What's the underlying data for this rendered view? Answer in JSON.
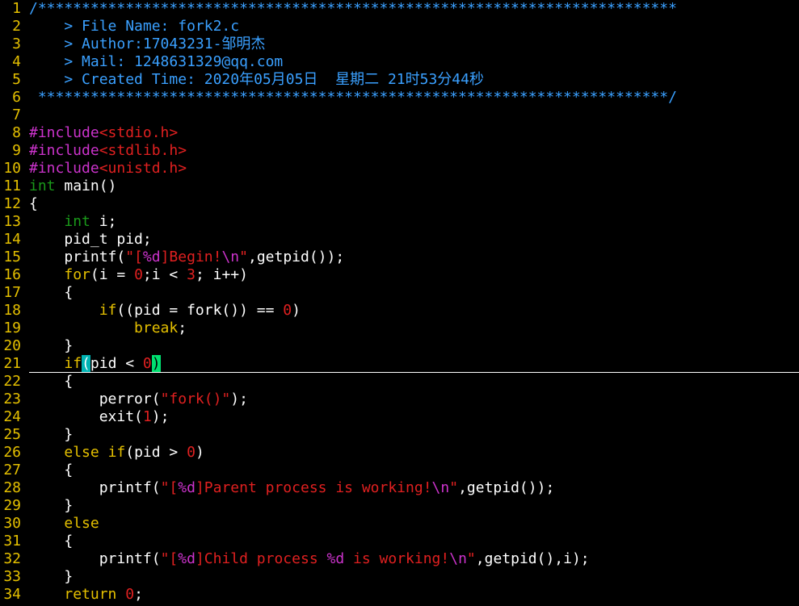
{
  "colors": {
    "background": "#000000",
    "line_number": "#e5c000",
    "comment": "#3aa0ff",
    "preprocessor": "#cc33cc",
    "string": "#e02020",
    "type": "#1a9a1a",
    "keyword": "#e5c000",
    "number": "#e02020",
    "plain": "#ffffff",
    "paren_match": "#00b4b4",
    "cursor": "#00e070"
  },
  "editor": {
    "cursor_line": 21,
    "lines": [
      {
        "n": "1",
        "segs": [
          {
            "t": "/*************************************************************************",
            "c": "comment"
          }
        ]
      },
      {
        "n": "2",
        "segs": [
          {
            "t": "    > File Name: fork2.c",
            "c": "comment"
          }
        ]
      },
      {
        "n": "3",
        "segs": [
          {
            "t": "    > Author:17043231-邹明杰",
            "c": "comment"
          }
        ]
      },
      {
        "n": "4",
        "segs": [
          {
            "t": "    > Mail: 1248631329@qq.com",
            "c": "comment"
          }
        ]
      },
      {
        "n": "5",
        "segs": [
          {
            "t": "    > Created Time: 2020年05月05日  星期二 21时53分44秒",
            "c": "comment"
          }
        ]
      },
      {
        "n": "6",
        "segs": [
          {
            "t": " ************************************************************************/",
            "c": "comment"
          }
        ]
      },
      {
        "n": "7",
        "segs": []
      },
      {
        "n": "8",
        "segs": [
          {
            "t": "#include",
            "c": "pre"
          },
          {
            "t": "<stdio.h>",
            "c": "str"
          }
        ]
      },
      {
        "n": "9",
        "segs": [
          {
            "t": "#include",
            "c": "pre"
          },
          {
            "t": "<stdlib.h>",
            "c": "str"
          }
        ]
      },
      {
        "n": "10",
        "segs": [
          {
            "t": "#include",
            "c": "pre"
          },
          {
            "t": "<unistd.h>",
            "c": "str"
          }
        ]
      },
      {
        "n": "11",
        "segs": [
          {
            "t": "int",
            "c": "type"
          },
          {
            "t": " main()",
            "c": "plain"
          }
        ]
      },
      {
        "n": "12",
        "segs": [
          {
            "t": "{",
            "c": "plain"
          }
        ]
      },
      {
        "n": "13",
        "segs": [
          {
            "t": "    ",
            "c": "plain"
          },
          {
            "t": "int",
            "c": "type"
          },
          {
            "t": " i;",
            "c": "plain"
          }
        ]
      },
      {
        "n": "14",
        "segs": [
          {
            "t": "    pid_t pid;",
            "c": "plain"
          }
        ]
      },
      {
        "n": "15",
        "segs": [
          {
            "t": "    printf(",
            "c": "plain"
          },
          {
            "t": "\"[",
            "c": "str"
          },
          {
            "t": "%d",
            "c": "fmt"
          },
          {
            "t": "]Begin!",
            "c": "str"
          },
          {
            "t": "\\n",
            "c": "fmt"
          },
          {
            "t": "\"",
            "c": "str"
          },
          {
            "t": ",getpid());",
            "c": "plain"
          }
        ]
      },
      {
        "n": "16",
        "segs": [
          {
            "t": "    ",
            "c": "plain"
          },
          {
            "t": "for",
            "c": "kw"
          },
          {
            "t": "(i = ",
            "c": "plain"
          },
          {
            "t": "0",
            "c": "num"
          },
          {
            "t": ";i < ",
            "c": "plain"
          },
          {
            "t": "3",
            "c": "num"
          },
          {
            "t": "; i++)",
            "c": "plain"
          }
        ]
      },
      {
        "n": "17",
        "segs": [
          {
            "t": "    {",
            "c": "plain"
          }
        ]
      },
      {
        "n": "18",
        "segs": [
          {
            "t": "        ",
            "c": "plain"
          },
          {
            "t": "if",
            "c": "kw"
          },
          {
            "t": "((pid = fork()) == ",
            "c": "plain"
          },
          {
            "t": "0",
            "c": "num"
          },
          {
            "t": ")",
            "c": "plain"
          }
        ]
      },
      {
        "n": "19",
        "segs": [
          {
            "t": "            ",
            "c": "plain"
          },
          {
            "t": "break",
            "c": "kw"
          },
          {
            "t": ";",
            "c": "plain"
          }
        ]
      },
      {
        "n": "20",
        "segs": [
          {
            "t": "    }",
            "c": "plain"
          }
        ]
      },
      {
        "n": "21",
        "segs": [
          {
            "t": "    ",
            "c": "plain"
          },
          {
            "t": "if",
            "c": "kw"
          },
          {
            "t": "(",
            "c": "paren"
          },
          {
            "t": "pid < ",
            "c": "plain"
          },
          {
            "t": "0",
            "c": "num"
          },
          {
            "t": ")",
            "c": "cursor"
          }
        ]
      },
      {
        "n": "22",
        "segs": [
          {
            "t": "    {",
            "c": "plain"
          }
        ]
      },
      {
        "n": "23",
        "segs": [
          {
            "t": "        perror(",
            "c": "plain"
          },
          {
            "t": "\"fork()\"",
            "c": "str"
          },
          {
            "t": ");",
            "c": "plain"
          }
        ]
      },
      {
        "n": "24",
        "segs": [
          {
            "t": "        exit(",
            "c": "plain"
          },
          {
            "t": "1",
            "c": "num"
          },
          {
            "t": ");",
            "c": "plain"
          }
        ]
      },
      {
        "n": "25",
        "segs": [
          {
            "t": "    }",
            "c": "plain"
          }
        ]
      },
      {
        "n": "26",
        "segs": [
          {
            "t": "    ",
            "c": "plain"
          },
          {
            "t": "else",
            "c": "kw"
          },
          {
            "t": " ",
            "c": "plain"
          },
          {
            "t": "if",
            "c": "kw"
          },
          {
            "t": "(pid > ",
            "c": "plain"
          },
          {
            "t": "0",
            "c": "num"
          },
          {
            "t": ")",
            "c": "plain"
          }
        ]
      },
      {
        "n": "27",
        "segs": [
          {
            "t": "    {",
            "c": "plain"
          }
        ]
      },
      {
        "n": "28",
        "segs": [
          {
            "t": "        printf(",
            "c": "plain"
          },
          {
            "t": "\"[",
            "c": "str"
          },
          {
            "t": "%d",
            "c": "fmt"
          },
          {
            "t": "]Parent process is working!",
            "c": "str"
          },
          {
            "t": "\\n",
            "c": "fmt"
          },
          {
            "t": "\"",
            "c": "str"
          },
          {
            "t": ",getpid());",
            "c": "plain"
          }
        ]
      },
      {
        "n": "29",
        "segs": [
          {
            "t": "    }",
            "c": "plain"
          }
        ]
      },
      {
        "n": "30",
        "segs": [
          {
            "t": "    ",
            "c": "plain"
          },
          {
            "t": "else",
            "c": "kw"
          }
        ]
      },
      {
        "n": "31",
        "segs": [
          {
            "t": "    {",
            "c": "plain"
          }
        ]
      },
      {
        "n": "32",
        "segs": [
          {
            "t": "        printf(",
            "c": "plain"
          },
          {
            "t": "\"[",
            "c": "str"
          },
          {
            "t": "%d",
            "c": "fmt"
          },
          {
            "t": "]Child process ",
            "c": "str"
          },
          {
            "t": "%d",
            "c": "fmt"
          },
          {
            "t": " is working!",
            "c": "str"
          },
          {
            "t": "\\n",
            "c": "fmt"
          },
          {
            "t": "\"",
            "c": "str"
          },
          {
            "t": ",getpid(),i);",
            "c": "plain"
          }
        ]
      },
      {
        "n": "33",
        "segs": [
          {
            "t": "    }",
            "c": "plain"
          }
        ]
      },
      {
        "n": "34",
        "segs": [
          {
            "t": "    ",
            "c": "plain"
          },
          {
            "t": "return",
            "c": "kw"
          },
          {
            "t": " ",
            "c": "plain"
          },
          {
            "t": "0",
            "c": "num"
          },
          {
            "t": ";",
            "c": "plain"
          }
        ]
      }
    ]
  }
}
